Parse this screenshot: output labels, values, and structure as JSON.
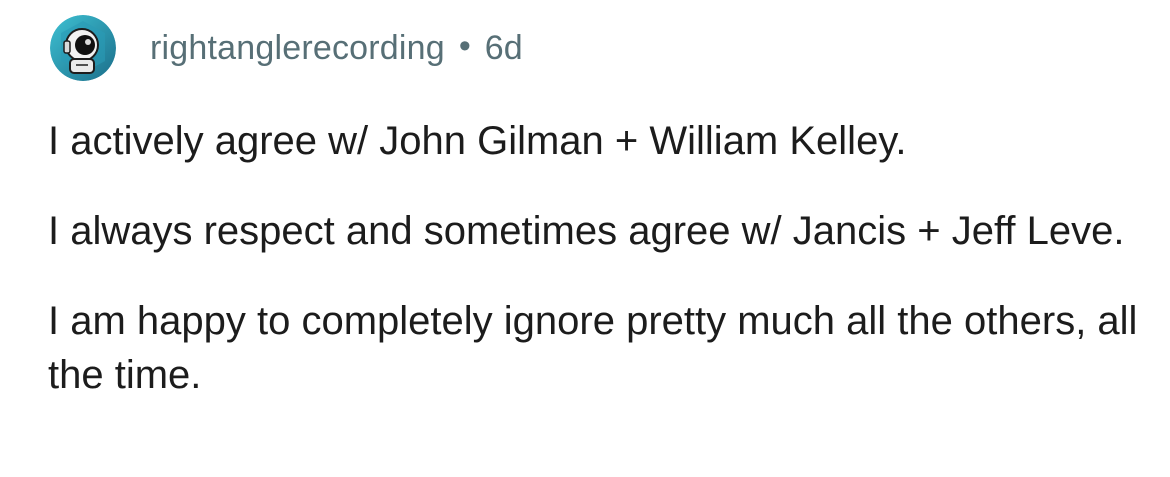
{
  "comment": {
    "author": "rightanglerecording",
    "separator": "•",
    "age": "6d",
    "avatar_icon": "astronaut-avatar-icon",
    "paragraphs": [
      "I actively agree w/ John Gilman + William Kelley.",
      "I always respect and sometimes agree w/ Jancis + Jeff Leve.",
      "I am happy to completely ignore pretty much all the others, all the time."
    ]
  },
  "colors": {
    "meta_text": "#576f76",
    "body_text": "#1c1c1c",
    "background": "#ffffff"
  }
}
